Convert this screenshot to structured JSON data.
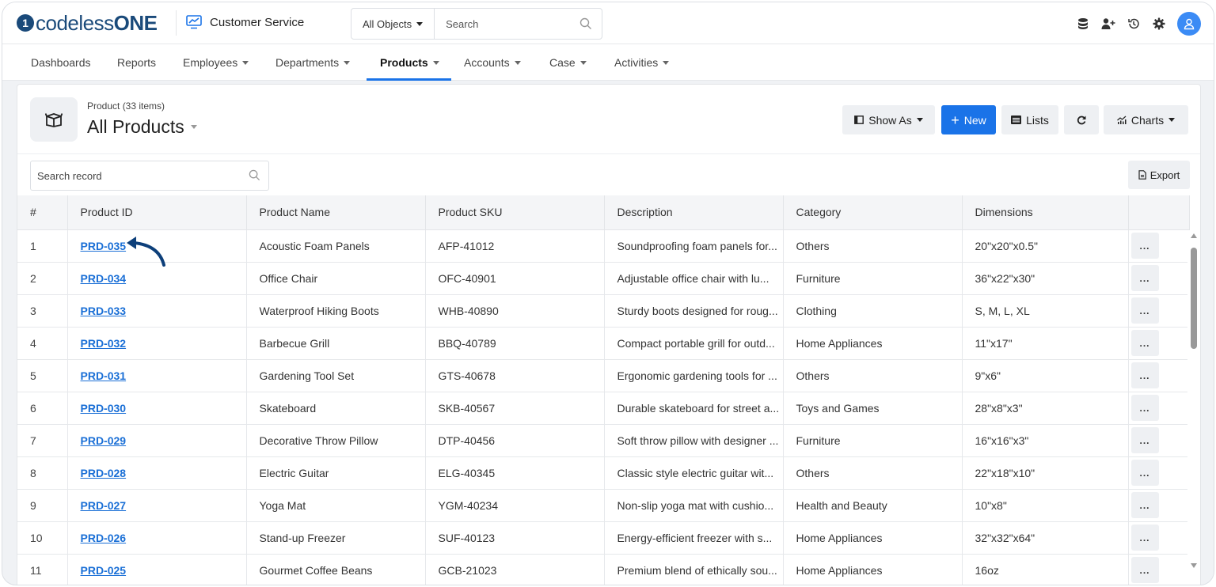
{
  "brand": {
    "name_light": "codeless",
    "name_bold": "ONE"
  },
  "app": {
    "name": "Customer Service"
  },
  "global_search": {
    "scope": "All Objects",
    "placeholder": "Search"
  },
  "top_icons": [
    "database-icon",
    "add-user-icon",
    "history-icon",
    "settings-icon",
    "user-avatar-icon"
  ],
  "nav": {
    "items": [
      {
        "label": "Dashboards"
      },
      {
        "label": "Reports"
      },
      {
        "label": "Employees"
      },
      {
        "label": "Departments"
      },
      {
        "label": "Products"
      },
      {
        "label": "Accounts"
      },
      {
        "label": "Case"
      },
      {
        "label": "Activities"
      }
    ],
    "active": "Products"
  },
  "view": {
    "count_label": "Product (33 items)",
    "title": "All Products"
  },
  "toolbar": {
    "show_as": "Show As",
    "new": "New",
    "lists": "Lists",
    "charts": "Charts",
    "export": "Export"
  },
  "record_search": {
    "placeholder": "Search record"
  },
  "table": {
    "columns": [
      "#",
      "Product ID",
      "Product Name",
      "Product SKU",
      "Description",
      "Category",
      "Dimensions"
    ],
    "rows": [
      {
        "n": "1",
        "id": "PRD-035",
        "name": "Acoustic Foam Panels",
        "sku": "AFP-41012",
        "desc": "Soundproofing foam panels for...",
        "cat": "Others",
        "dim": "20\"x20\"x0.5\""
      },
      {
        "n": "2",
        "id": "PRD-034",
        "name": "Office Chair",
        "sku": "OFC-40901",
        "desc": "Adjustable office chair with lu...",
        "cat": "Furniture",
        "dim": "36\"x22\"x30\""
      },
      {
        "n": "3",
        "id": "PRD-033",
        "name": "Waterproof Hiking Boots",
        "sku": "WHB-40890",
        "desc": "Sturdy boots designed for roug...",
        "cat": "Clothing",
        "dim": "S, M, L, XL"
      },
      {
        "n": "4",
        "id": "PRD-032",
        "name": "Barbecue Grill",
        "sku": "BBQ-40789",
        "desc": "Compact portable grill for outd...",
        "cat": "Home Appliances",
        "dim": "11\"x17\""
      },
      {
        "n": "5",
        "id": "PRD-031",
        "name": "Gardening Tool Set",
        "sku": "GTS-40678",
        "desc": "Ergonomic gardening tools for ...",
        "cat": "Others",
        "dim": "9\"x6\""
      },
      {
        "n": "6",
        "id": "PRD-030",
        "name": "Skateboard",
        "sku": "SKB-40567",
        "desc": "Durable skateboard for street a...",
        "cat": "Toys and Games",
        "dim": "28\"x8\"x3\""
      },
      {
        "n": "7",
        "id": "PRD-029",
        "name": "Decorative Throw Pillow",
        "sku": "DTP-40456",
        "desc": "Soft throw pillow with designer ...",
        "cat": "Furniture",
        "dim": "16\"x16\"x3\""
      },
      {
        "n": "8",
        "id": "PRD-028",
        "name": "Electric Guitar",
        "sku": "ELG-40345",
        "desc": "Classic style electric guitar wit...",
        "cat": "Others",
        "dim": "22\"x18\"x10\""
      },
      {
        "n": "9",
        "id": "PRD-027",
        "name": "Yoga Mat",
        "sku": "YGM-40234",
        "desc": "Non-slip yoga mat with cushio...",
        "cat": "Health and Beauty",
        "dim": "10\"x8\""
      },
      {
        "n": "10",
        "id": "PRD-026",
        "name": "Stand-up Freezer",
        "sku": "SUF-40123",
        "desc": "Energy-efficient freezer with s...",
        "cat": "Home Appliances",
        "dim": "32\"x32\"x64\""
      },
      {
        "n": "11",
        "id": "PRD-025",
        "name": "Gourmet Coffee Beans",
        "sku": "GCB-21023",
        "desc": "Premium blend of ethically sou...",
        "cat": "Home Appliances",
        "dim": "16oz"
      }
    ],
    "row_action_label": "..."
  },
  "colors": {
    "brand": "#1a4a7a",
    "accent": "#1a73e8",
    "link": "#1a6fd6",
    "annotation": "#0d3f7a"
  }
}
